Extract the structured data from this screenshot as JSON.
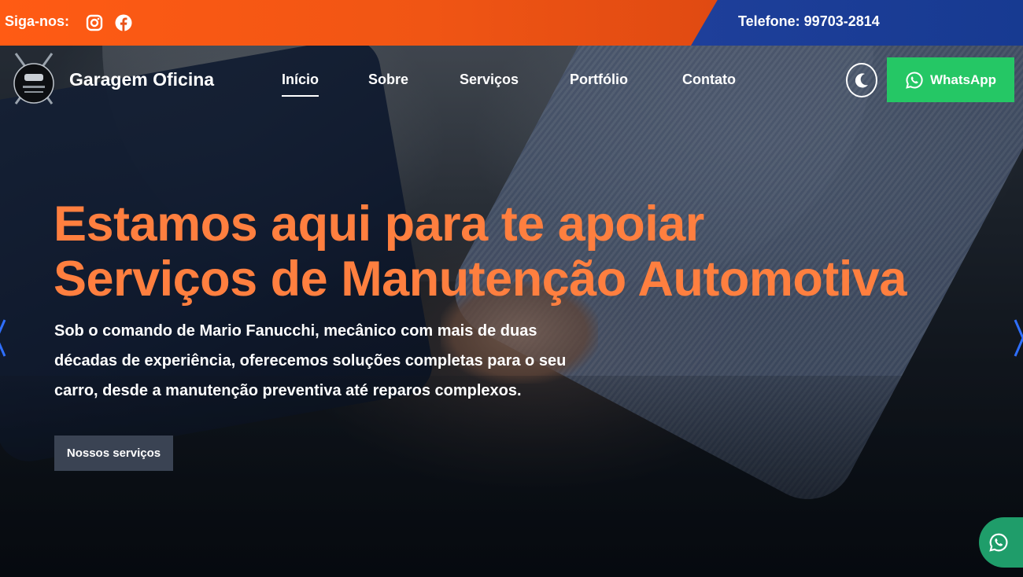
{
  "topbar": {
    "follow_label": "Siga-nos:",
    "social_icons": [
      "instagram-icon",
      "facebook-icon"
    ],
    "phone": "Telefone: 99703-2814"
  },
  "header": {
    "brand": "Garagem Oficina",
    "logo_text": "Garagem Oficina",
    "nav": [
      "Início",
      "Sobre",
      "Serviços",
      "Portfólio",
      "Contato"
    ],
    "active_nav": "Início",
    "whatsapp_label": "WhatsApp"
  },
  "hero": {
    "headline_line1": "Estamos aqui para te apoiar",
    "headline_line2": "Serviços de Manutenção Automotiva",
    "description": "Sob o comando de Mario Fanucchi, mecânico com mais de duas décadas de experiência, oferecemos soluções completas para o seu carro, desde a manutenção preventiva até reparos complexos.",
    "cta_label": "Nossos serviços"
  },
  "colors": {
    "orange": "#ff5b14",
    "blue": "#1e3f9a",
    "headline": "#ff7f3f",
    "whatsapp": "#25c765",
    "cta": "#3a4353"
  }
}
